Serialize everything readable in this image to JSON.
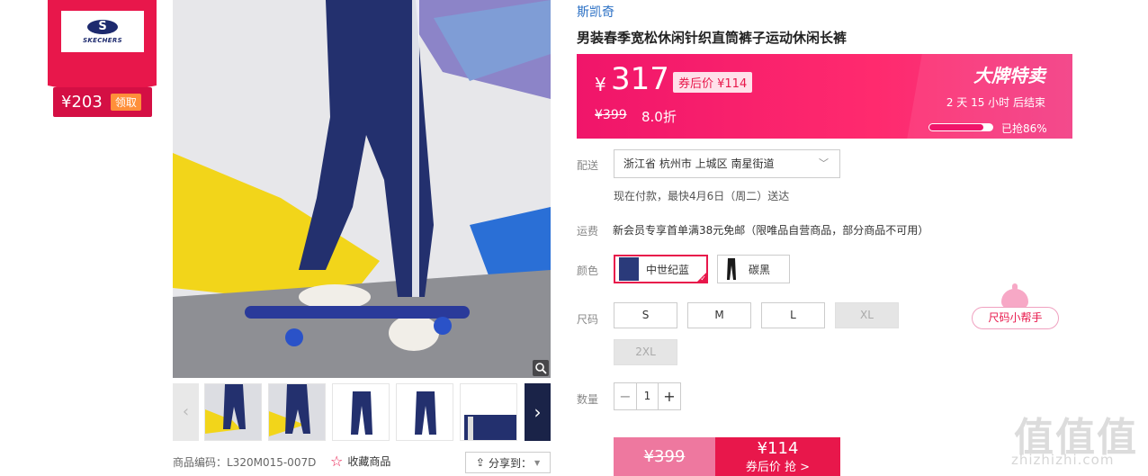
{
  "brand_badge": {
    "logo_text": "SKECHERS",
    "coupon_price": "¥203",
    "coupon_action": "领取"
  },
  "product": {
    "brand": "斯凯奇",
    "title": "男装春季宽松休闲针织直筒裤子运动休闲长裤",
    "sku_label": "商品编码：L320M015-007D",
    "favorite_label": "收藏商品",
    "share_label": "分享到："
  },
  "price": {
    "currency": "¥",
    "current": "317",
    "after_coupon_label": "券后价 ¥114",
    "original": "¥399",
    "discount": "8.0折",
    "flash_title": "大牌特卖",
    "countdown": "2 天 15 小时 后结束",
    "sold_label": "已抢86%",
    "sold_fraction": 0.86
  },
  "delivery": {
    "label": "配送",
    "address": "浙江省 杭州市 上城区 南星街道",
    "note": "现在付款，最快4月6日（周二）送达"
  },
  "shipping": {
    "label": "运费",
    "note": "新会员专享首单满38元免邮（限唯品自营商品，部分商品不可用）"
  },
  "color": {
    "label": "颜色",
    "options": [
      {
        "name": "中世纪蓝",
        "selected": true,
        "swatch": "#2a3a7a"
      },
      {
        "name": "碳黑",
        "selected": false,
        "swatch": "#1a1a1a"
      }
    ]
  },
  "size": {
    "label": "尺码",
    "options": [
      {
        "name": "S",
        "available": true
      },
      {
        "name": "M",
        "available": true
      },
      {
        "name": "L",
        "available": true
      },
      {
        "name": "XL",
        "available": false
      },
      {
        "name": "2XL",
        "available": false
      }
    ],
    "helper": "尺码小帮手"
  },
  "quantity": {
    "label": "数量",
    "value": "1"
  },
  "buy": {
    "original_price": "¥399",
    "coupon_price": "¥114",
    "coupon_action": "券后价 抢 >"
  },
  "watermark": {
    "text": "值值值",
    "url": "zhizhizhi.com"
  },
  "colors": {
    "accent": "#e8174b",
    "link": "#2a6fc4",
    "banner": "#f0156a"
  }
}
